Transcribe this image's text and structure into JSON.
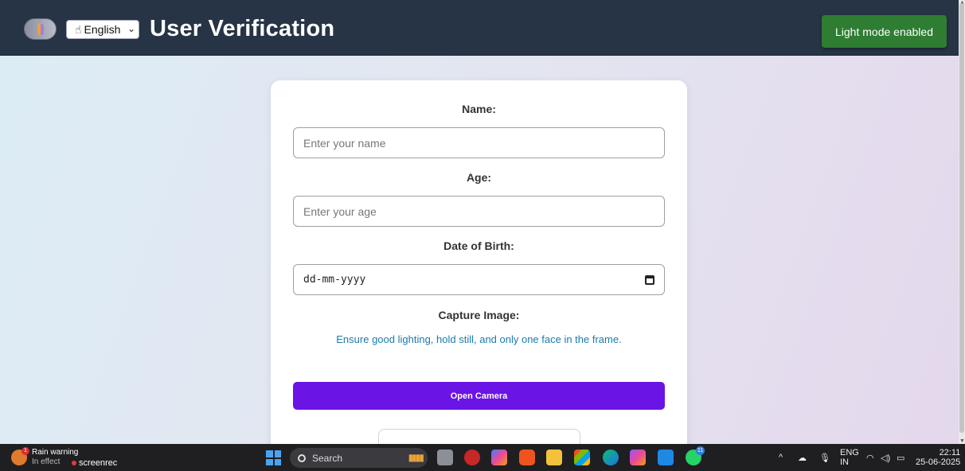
{
  "header": {
    "language": "English",
    "title": "User Verification",
    "mode_badge": "Light mode enabled"
  },
  "form": {
    "name_label": "Name:",
    "name_placeholder": "Enter your name",
    "age_label": "Age:",
    "age_placeholder": "Enter your age",
    "dob_label": "Date of Birth:",
    "dob_value": "dd-mm-yyyy",
    "capture_label": "Capture Image:",
    "capture_hint": "Ensure good lighting, hold still, and only one face in the frame.",
    "camera_button": "Open Camera"
  },
  "taskbar": {
    "weather_title": "Rain warning",
    "weather_sub": "In effect",
    "weather_badge": "1",
    "recorder": "screenrec",
    "search": "Search",
    "whatsapp_badge": "11",
    "lang_top": "ENG",
    "lang_bottom": "IN",
    "time": "22:11",
    "date": "25-06-2025"
  },
  "colors": {
    "header_bg": "#263445",
    "badge_green": "#2e7d32",
    "primary_button": "#6a14e6",
    "hint_text": "#1a7bb0"
  },
  "icons": {
    "theme_toggle": "sun-moon-toggle-icon",
    "language": "hand-pointer-icon",
    "date": "calendar-icon"
  }
}
